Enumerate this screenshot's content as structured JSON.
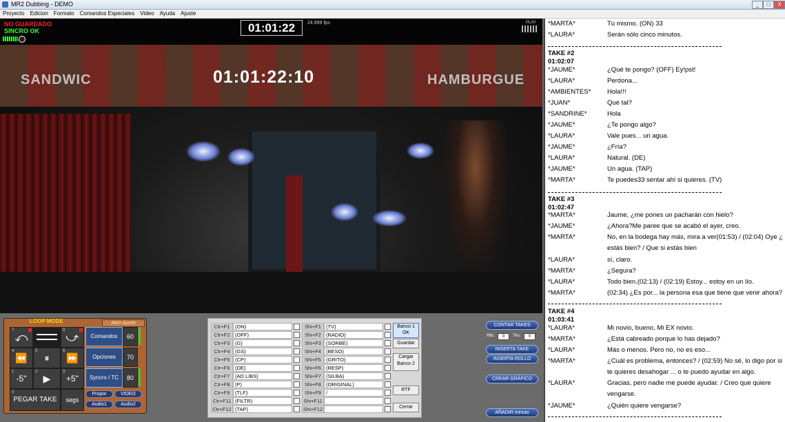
{
  "window": {
    "title": "MR2 Dubbing - DEMO",
    "min": "_",
    "max": "□",
    "close": "X"
  },
  "menu": [
    "Proyecto",
    "Edicion",
    "Formato",
    "Comandos Especiales",
    "Video",
    "Ayuda",
    "Ajuste"
  ],
  "video": {
    "status_save": "NO GUARDADO",
    "status_sync": "SINCRO OK",
    "timecode_box": "01:01:22",
    "fps": "24.999 fps",
    "play": "PLAY",
    "burned_timecode": "01:01:22:10",
    "sign_left": "SANDWIC",
    "sign_right": "HAMBURGUE"
  },
  "loop": {
    "title": "LOOP MODE",
    "abrir": "Abrir Ajuste",
    "key7": "7",
    "key9": "9",
    "key4": "4",
    "key5": "5",
    "key6": "6",
    "key1": "1",
    "key2": "2",
    "key3": "3",
    "key0": "0",
    "minus5": "-5\"",
    "plus5": "+5\"",
    "pegar": "PEGAR TAKE",
    "segs": "segs",
    "comandos": "Comandos",
    "opciones": "Opciones",
    "sincro": "Syncro / TC",
    "n60": "60",
    "n70": "70",
    "n80": "80",
    "proppor": "Propor",
    "video": "VIDEO",
    "audio1": "Audio1",
    "audio2": "Audio2"
  },
  "shortcuts": {
    "left": [
      {
        "key": "Ctr+F1",
        "val": "(ON)"
      },
      {
        "key": "Ctr+F2",
        "val": "(OFF)"
      },
      {
        "key": "Ctr+F3",
        "val": "(G)"
      },
      {
        "key": "Ctr+F4",
        "val": "(GS)"
      },
      {
        "key": "Ctr+F5",
        "val": "(CP)"
      },
      {
        "key": "Ctr+F6",
        "val": "(DE)"
      },
      {
        "key": "Ctr+F7",
        "val": "(AD LIBS)"
      },
      {
        "key": "Ctr+F8",
        "val": "(P)"
      },
      {
        "key": "Ctr+F9",
        "val": "(TLF)"
      },
      {
        "key": "Ctr+F11",
        "val": "(FILTR)"
      },
      {
        "key": "Ctr+F12",
        "val": "(TAP)"
      }
    ],
    "right": [
      {
        "key": "Shi+F1",
        "val": "(TV)"
      },
      {
        "key": "Shi+F2",
        "val": "(RADIO)"
      },
      {
        "key": "Shi+F3",
        "val": "(SORBE)"
      },
      {
        "key": "Shi+F4",
        "val": "(BESO)"
      },
      {
        "key": "Shi+F5",
        "val": "(GRITO)"
      },
      {
        "key": "Shi+F6",
        "val": "(RESP)"
      },
      {
        "key": "Shi+F7",
        "val": "(SILBA)"
      },
      {
        "key": "Shi+F8",
        "val": "(ORIGINAL)"
      },
      {
        "key": "Shi+F9",
        "val": "/"
      },
      {
        "key": "Shi+F11",
        "val": ""
      },
      {
        "key": "Shi+F12",
        "val": ""
      }
    ],
    "banco1_a": "Banco 1",
    "banco1_b": "OK",
    "guardar": "Guardar",
    "cargar_a": "Cargar",
    "cargar_b": "Banco 2",
    "rtf": "RTF",
    "cerrar": "Cerrar"
  },
  "takes_panel": {
    "contar": "CONTAR TAKES",
    "rlls_label": "Rlls:",
    "rlls_val": "0",
    "tks_label": "Tks:",
    "tks_val": "0",
    "inserta_take": "INSERTA TAKE",
    "inserta_rollo": "INSERTA ROLLO",
    "crear": "CREAR GRÁFICO",
    "anadir": "AÑADIR minuto"
  },
  "script": {
    "top": [
      {
        "c": "*MARTA*",
        "d": "Tú mismo. (ON) 33"
      },
      {
        "c": "*LAURA*",
        "d": "Serán sólo cinco minutos."
      }
    ],
    "take2": {
      "title": "TAKE #2",
      "tc": "01:02:07",
      "lines": [
        {
          "c": "*JAUME*",
          "d": "¿Qué te pongo?  (OFF) Ey!pst!"
        },
        {
          "c": "*LAURA*",
          "d": "Perdona..."
        },
        {
          "c": "*AMBIENTES*",
          "d": "Hola!!!"
        },
        {
          "c": "*JUAN*",
          "d": "Qué tal?"
        },
        {
          "c": "*SANDRINE*",
          "d": "Hola"
        },
        {
          "c": "*JAUME*",
          "d": "¿Te pongo algo?"
        },
        {
          "c": "*LAURA*",
          "d": "Vale pues... un agua."
        },
        {
          "c": "*JAUME*",
          "d": "¿Fría?"
        },
        {
          "c": "*LAURA*",
          "d": "Natural. (DE)"
        },
        {
          "c": "*JAUME*",
          "d": "Un agua. (TAP)"
        },
        {
          "c": "*MARTA*",
          "d": "Te puedes33 sentar ahí si quieres. (TV)"
        }
      ]
    },
    "take3": {
      "title": "TAKE #3",
      "tc": "01:02:47",
      "lines": [
        {
          "c": "*MARTA*",
          "d": "Jaume, ¿me pones un pacharán con hielo?"
        },
        {
          "c": "*JAUME*",
          "d": "¿Ahora?Me paree que se acabó el ayer, creo."
        },
        {
          "c": "*MARTA*",
          "d": "No, en la bodega hay más, mira a ver(01:53)  / (02:04) Oye ¿"
        },
        {
          "c": "",
          "d": "estás bien? / Que si estás bien"
        },
        {
          "c": "*LAURA*",
          "d": "sí, claro."
        },
        {
          "c": "*MARTA*",
          "d": "¿Segura?"
        },
        {
          "c": "*LAURA*",
          "d": "Todo bien.(02:13)  / (02:19) Estoy... estoy en un lío."
        },
        {
          "c": "*MARTA*",
          "d": "(02:34) ¿Es por... la persona esa que tiene que venir ahora?"
        }
      ]
    },
    "take4": {
      "title": "TAKE #4",
      "tc": "01:03:41",
      "lines": [
        {
          "c": "*LAURA*",
          "d": "Mi novio, bueno, Mi EX novio."
        },
        {
          "c": "*MARTA*",
          "d": "¿Está cabreado porque lo has dejado?"
        },
        {
          "c": "*LAURA*",
          "d": "Más o menos. Pero no, no es eso..."
        },
        {
          "c": "*MARTA*",
          "d": "¿Cuál es problema, entonces? / (02:59) No sé, lo digo por si"
        },
        {
          "c": "",
          "d": "te quieres desahogar ... o te puedo ayudar en algo."
        },
        {
          "c": "*LAURA*",
          "d": "Gracias, pero nadie me puede ayudar. / Creo que quiere"
        },
        {
          "c": "",
          "d": "vengarse."
        },
        {
          "c": "*JAUME*",
          "d": "¿Quién quiere vengarse?"
        }
      ]
    }
  }
}
